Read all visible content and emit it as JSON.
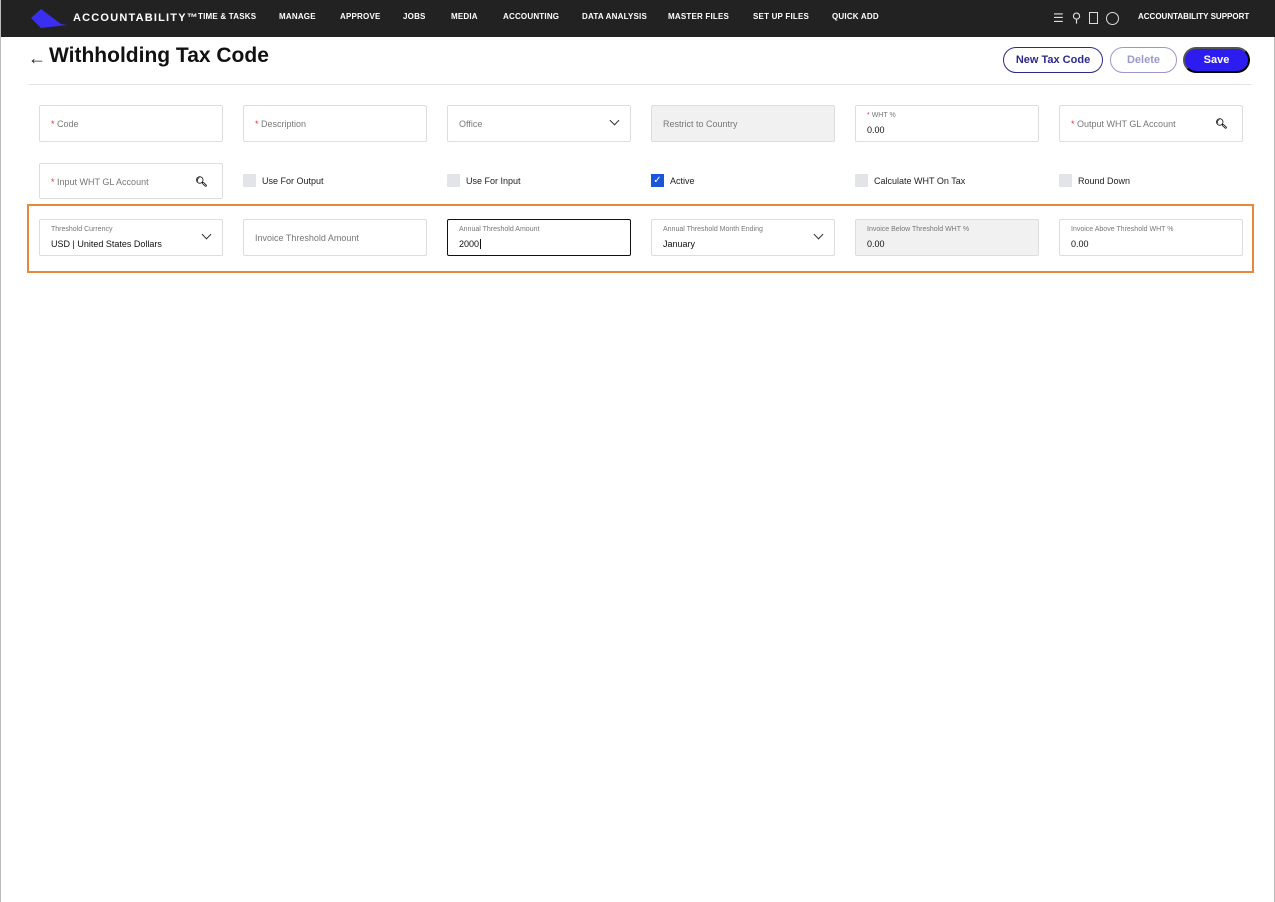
{
  "nav": {
    "brand": "ACCOUNTABILITY™",
    "items": [
      "TIME & TASKS",
      "MANAGE",
      "APPROVE",
      "JOBS",
      "MEDIA",
      "ACCOUNTING",
      "DATA ANALYSIS",
      "MASTER FILES",
      "SET UP FILES",
      "QUICK ADD"
    ],
    "user": "ACCOUNTABILITY SUPPORT"
  },
  "page": {
    "title": "Withholding Tax Code",
    "buttons": {
      "new": "New Tax Code",
      "delete": "Delete",
      "save": "Save"
    }
  },
  "row1": {
    "code": "Code",
    "description": "Description",
    "office": "Office",
    "restrict": "Restrict to Country",
    "wht_label": "WHT %",
    "wht_value": "0.00",
    "output_gl": "Output WHT GL Account"
  },
  "row2": {
    "input_gl": "Input WHT GL Account",
    "use_output": "Use For Output",
    "use_input": "Use For Input",
    "active": "Active",
    "calc_wht": "Calculate WHT On Tax",
    "round_down": "Round Down"
  },
  "row3": {
    "currency_label": "Threshold Currency",
    "currency_value": "USD | United States Dollars",
    "invoice_threshold": "Invoice Threshold Amount",
    "annual_label": "Annual Threshold Amount",
    "annual_value": "2000",
    "month_label": "Annual Threshold Month Ending",
    "month_value": "January",
    "below_label": "Invoice Below Threshold WHT %",
    "below_value": "0.00",
    "above_label": "Invoice Above Threshold WHT %",
    "above_value": "0.00"
  },
  "req": "*"
}
